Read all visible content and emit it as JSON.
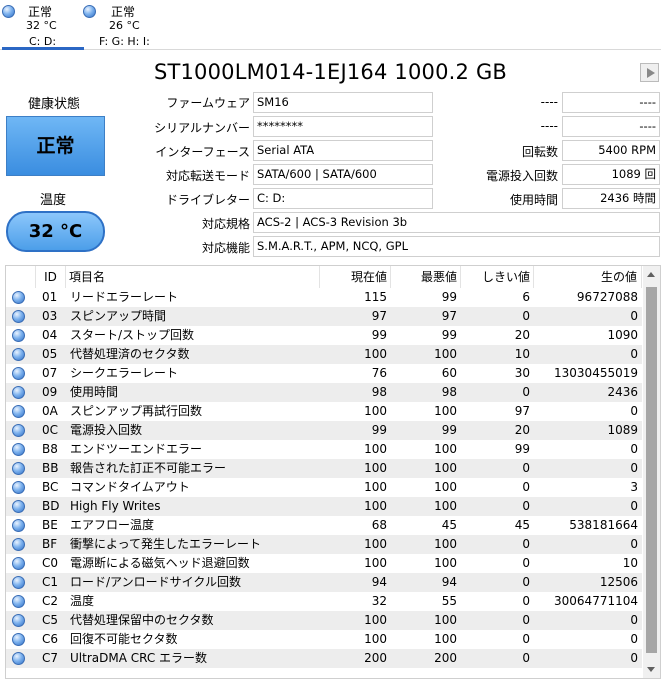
{
  "disks": [
    {
      "status": "正常",
      "temp": "32 °C",
      "drives": "C: D:"
    },
    {
      "status": "正常",
      "temp": "26 °C",
      "drives": "F: G: H: I:"
    }
  ],
  "title": "ST1000LM014-1EJ164 1000.2 GB",
  "health": {
    "label": "健康状態",
    "status": "正常"
  },
  "temperature": {
    "label": "温度",
    "value": "32 °C"
  },
  "info": {
    "firmware_label": "ファームウェア",
    "firmware": "SM16",
    "serial_label": "シリアルナンバー",
    "serial": "********",
    "interface_label": "インターフェース",
    "interface": "Serial ATA",
    "transfer_label": "対応転送モード",
    "transfer": "SATA/600 | SATA/600",
    "drive_label": "ドライブレター",
    "drive": "C: D:",
    "standard_label": "対応規格",
    "standard": "ACS-2 | ACS-3 Revision 3b",
    "features_label": "対応機能",
    "features": "S.M.A.R.T., APM, NCQ, GPL",
    "r1_label": "----",
    "r1_value": "----",
    "r2_label": "----",
    "r2_value": "----",
    "rpm_label": "回転数",
    "rpm": "5400 RPM",
    "power_count_label": "電源投入回数",
    "power_count": "1089 回",
    "hours_label": "使用時間",
    "hours": "2436 時間"
  },
  "table": {
    "headers": {
      "id": "ID",
      "name": "項目名",
      "current": "現在値",
      "worst": "最悪値",
      "threshold": "しきい値",
      "raw": "生の値"
    },
    "rows": [
      {
        "id": "01",
        "name": "リードエラーレート",
        "current": "115",
        "worst": "99",
        "threshold": "6",
        "raw": "96727088"
      },
      {
        "id": "03",
        "name": "スピンアップ時間",
        "current": "97",
        "worst": "97",
        "threshold": "0",
        "raw": "0"
      },
      {
        "id": "04",
        "name": "スタート/ストップ回数",
        "current": "99",
        "worst": "99",
        "threshold": "20",
        "raw": "1090"
      },
      {
        "id": "05",
        "name": "代替処理済のセクタ数",
        "current": "100",
        "worst": "100",
        "threshold": "10",
        "raw": "0"
      },
      {
        "id": "07",
        "name": "シークエラーレート",
        "current": "76",
        "worst": "60",
        "threshold": "30",
        "raw": "13030455019"
      },
      {
        "id": "09",
        "name": "使用時間",
        "current": "98",
        "worst": "98",
        "threshold": "0",
        "raw": "2436"
      },
      {
        "id": "0A",
        "name": "スピンアップ再試行回数",
        "current": "100",
        "worst": "100",
        "threshold": "97",
        "raw": "0"
      },
      {
        "id": "0C",
        "name": "電源投入回数",
        "current": "99",
        "worst": "99",
        "threshold": "20",
        "raw": "1089"
      },
      {
        "id": "B8",
        "name": "エンドツーエンドエラー",
        "current": "100",
        "worst": "100",
        "threshold": "99",
        "raw": "0"
      },
      {
        "id": "BB",
        "name": "報告された訂正不可能エラー",
        "current": "100",
        "worst": "100",
        "threshold": "0",
        "raw": "0"
      },
      {
        "id": "BC",
        "name": "コマンドタイムアウト",
        "current": "100",
        "worst": "100",
        "threshold": "0",
        "raw": "3"
      },
      {
        "id": "BD",
        "name": "High Fly Writes",
        "current": "100",
        "worst": "100",
        "threshold": "0",
        "raw": "0"
      },
      {
        "id": "BE",
        "name": "エアフロー温度",
        "current": "68",
        "worst": "45",
        "threshold": "45",
        "raw": "538181664"
      },
      {
        "id": "BF",
        "name": "衝撃によって発生したエラーレート",
        "current": "100",
        "worst": "100",
        "threshold": "0",
        "raw": "0"
      },
      {
        "id": "C0",
        "name": "電源断による磁気ヘッド退避回数",
        "current": "100",
        "worst": "100",
        "threshold": "0",
        "raw": "10"
      },
      {
        "id": "C1",
        "name": "ロード/アンロードサイクル回数",
        "current": "94",
        "worst": "94",
        "threshold": "0",
        "raw": "12506"
      },
      {
        "id": "C2",
        "name": "温度",
        "current": "32",
        "worst": "55",
        "threshold": "0",
        "raw": "30064771104"
      },
      {
        "id": "C5",
        "name": "代替処理保留中のセクタ数",
        "current": "100",
        "worst": "100",
        "threshold": "0",
        "raw": "0"
      },
      {
        "id": "C6",
        "name": "回復不可能セクタ数",
        "current": "100",
        "worst": "100",
        "threshold": "0",
        "raw": "0"
      },
      {
        "id": "C7",
        "name": "UltraDMA CRC エラー数",
        "current": "200",
        "worst": "200",
        "threshold": "0",
        "raw": "0"
      }
    ]
  }
}
